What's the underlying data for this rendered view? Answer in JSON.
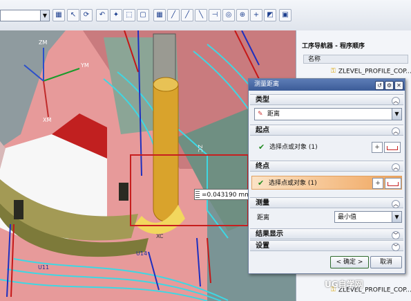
{
  "toolbar": {
    "icons": [
      "combo-box",
      "window-icon",
      "cursor-icon",
      "rotate-icon",
      "undo-icon",
      "snap-icon",
      "select-box-icon",
      "grid-icon",
      "line-icon",
      "line-icon",
      "line-icon",
      "arc-icon",
      "circle-icon",
      "point-icon",
      "plus-icon",
      "plane-icon",
      "cube-icon"
    ]
  },
  "viewport": {
    "measurement": "=0.043190 mm",
    "labels": [
      "ZM",
      "YM",
      "XM",
      "XC",
      "ZC",
      "YC",
      "U14",
      "U11"
    ]
  },
  "navigator": {
    "title": "工序导航器 - 程序顺序",
    "column_header": "名称",
    "items": [
      "ZLEVEL_PROFILE_COP...",
      "ZLEVEL_PROFILE_COP..."
    ]
  },
  "dialog": {
    "title": "测量距离",
    "section_type": "类型",
    "type_value": "距离",
    "section_start": "起点",
    "start_select": "选择点或对象 (1)",
    "section_end": "终点",
    "end_select": "选择点或对象 (1)",
    "section_measure": "测量",
    "distance_label": "距离",
    "distance_value": "最小值",
    "section_result": "结果显示",
    "section_settings": "设置",
    "ok_label": "< 确定 >",
    "cancel_label": "取消"
  },
  "watermark": "UG自学网"
}
